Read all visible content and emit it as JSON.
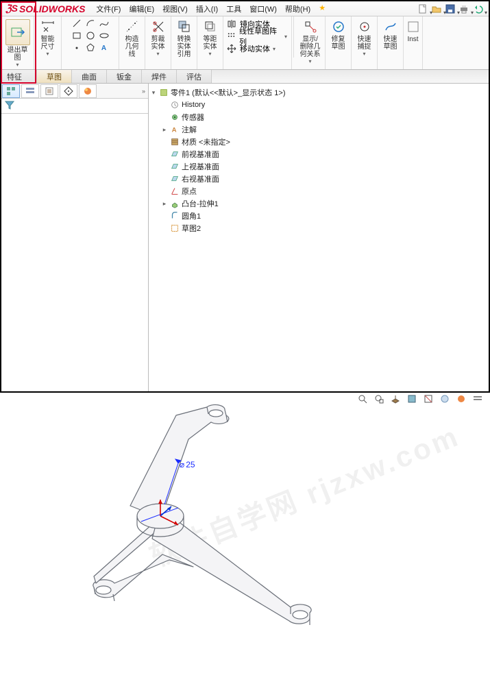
{
  "app": {
    "name": "SOLIDWORKS"
  },
  "menus": [
    "文件(F)",
    "编辑(E)",
    "视图(V)",
    "插入(I)",
    "工具",
    "窗口(W)",
    "帮助(H)"
  ],
  "ribbon": {
    "exit": "退出草图",
    "smartdim": "智能尺寸",
    "geom": "构造几何线",
    "trim": "剪裁实体",
    "convert": "转换实体引用",
    "offset": "等距实体",
    "mirror": "镜向实体",
    "pattern": "线性草图阵列",
    "move": "移动实体",
    "showhide": "显示/删除几何关系",
    "repair": "修复草图",
    "quicksnap": "快速捕捉",
    "rapid": "快速草图",
    "inst": "Inst"
  },
  "tabs": [
    "特征",
    "草图",
    "曲面",
    "钣金",
    "焊件",
    "评估"
  ],
  "active_tab": 1,
  "tree": {
    "root": "零件1 (默认<<默认>_显示状态 1>)",
    "items": [
      {
        "label": "History",
        "icon": "history"
      },
      {
        "label": "传感器",
        "icon": "sensor"
      },
      {
        "label": "注解",
        "icon": "annot",
        "expandable": true
      },
      {
        "label": "材质 <未指定>",
        "icon": "material"
      },
      {
        "label": "前视基准面",
        "icon": "plane"
      },
      {
        "label": "上视基准面",
        "icon": "plane"
      },
      {
        "label": "右视基准面",
        "icon": "plane"
      },
      {
        "label": "原点",
        "icon": "origin"
      },
      {
        "label": "凸台-拉伸1",
        "icon": "extrude",
        "expandable": true
      },
      {
        "label": "圆角1",
        "icon": "fillet"
      },
      {
        "label": "草图2",
        "icon": "sketch"
      }
    ]
  },
  "dimension": {
    "symbol": "⌀",
    "value": "25"
  },
  "watermark": "软件自学网 rjzxw.com"
}
